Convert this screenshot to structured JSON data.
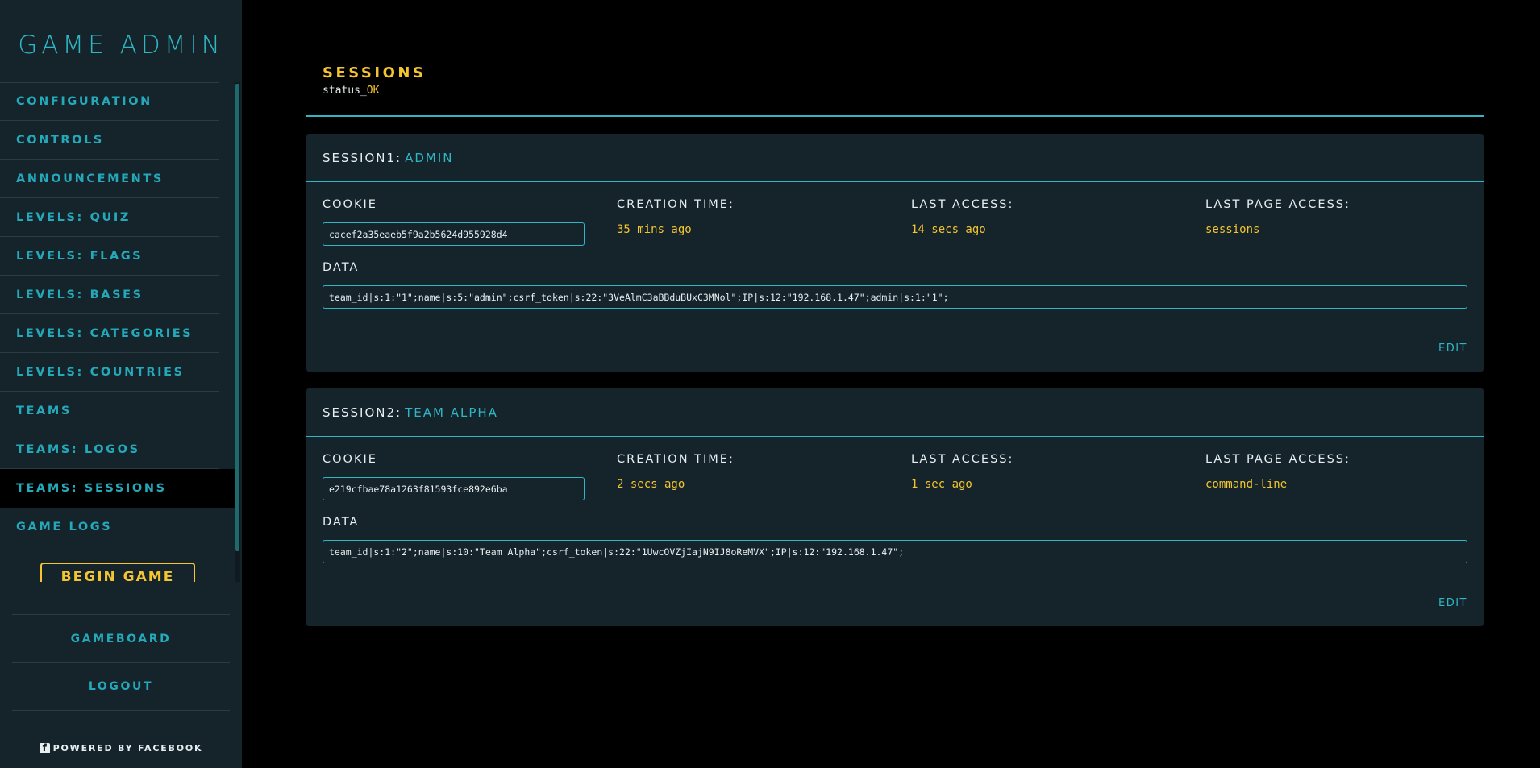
{
  "sidebar": {
    "brand": "GAME ADMIN",
    "items": [
      {
        "label": "CONFIGURATION"
      },
      {
        "label": "CONTROLS"
      },
      {
        "label": "ANNOUNCEMENTS"
      },
      {
        "label": "LEVELS: QUIZ"
      },
      {
        "label": "LEVELS: FLAGS"
      },
      {
        "label": "LEVELS: BASES"
      },
      {
        "label": "LEVELS: CATEGORIES"
      },
      {
        "label": "LEVELS: COUNTRIES"
      },
      {
        "label": "TEAMS"
      },
      {
        "label": "TEAMS: LOGOS"
      },
      {
        "label": "TEAMS: SESSIONS",
        "active": true
      },
      {
        "label": "GAME LOGS"
      }
    ],
    "begin_button": "BEGIN GAME",
    "bottom_links": [
      "GAMEBOARD",
      "LOGOUT"
    ],
    "powered_by": "POWERED BY FACEBOOK",
    "powered_icon": "facebook-icon"
  },
  "page": {
    "title": "SESSIONS",
    "status_prefix": "status_",
    "status_value": "OK"
  },
  "sessions": [
    {
      "title_prefix": "SESSION1:",
      "name": "ADMIN",
      "cookie_label": "COOKIE",
      "cookie": "cacef2a35eaeb5f9a2b5624d955928d4",
      "creation_label": "CREATION TIME:",
      "creation": "35 mins ago",
      "last_access_label": "LAST ACCESS:",
      "last_access": "14 secs ago",
      "last_page_label": "LAST PAGE ACCESS:",
      "last_page": "sessions",
      "data_label": "DATA",
      "data": "team_id|s:1:\"1\";name|s:5:\"admin\";csrf_token|s:22:\"3VeAlmC3aBBduBUxC3MNol\";IP|s:12:\"192.168.1.47\";admin|s:1:\"1\";",
      "edit_label": "EDIT"
    },
    {
      "title_prefix": "SESSION2:",
      "name": "TEAM ALPHA",
      "cookie_label": "COOKIE",
      "cookie": "e219cfbae78a1263f81593fce892e6ba",
      "creation_label": "CREATION TIME:",
      "creation": "2 secs ago",
      "last_access_label": "LAST ACCESS:",
      "last_access": "1 sec ago",
      "last_page_label": "LAST PAGE ACCESS:",
      "last_page": "command-line",
      "data_label": "DATA",
      "data": "team_id|s:1:\"2\";name|s:10:\"Team Alpha\";csrf_token|s:22:\"1UwcOVZjIajN9IJ8oReMVX\";IP|s:12:\"192.168.1.47\";",
      "edit_label": "EDIT"
    }
  ],
  "colors": {
    "accent": "#2fb6c4",
    "highlight": "#f4c52e",
    "panel": "#15242b",
    "background": "#000000"
  }
}
